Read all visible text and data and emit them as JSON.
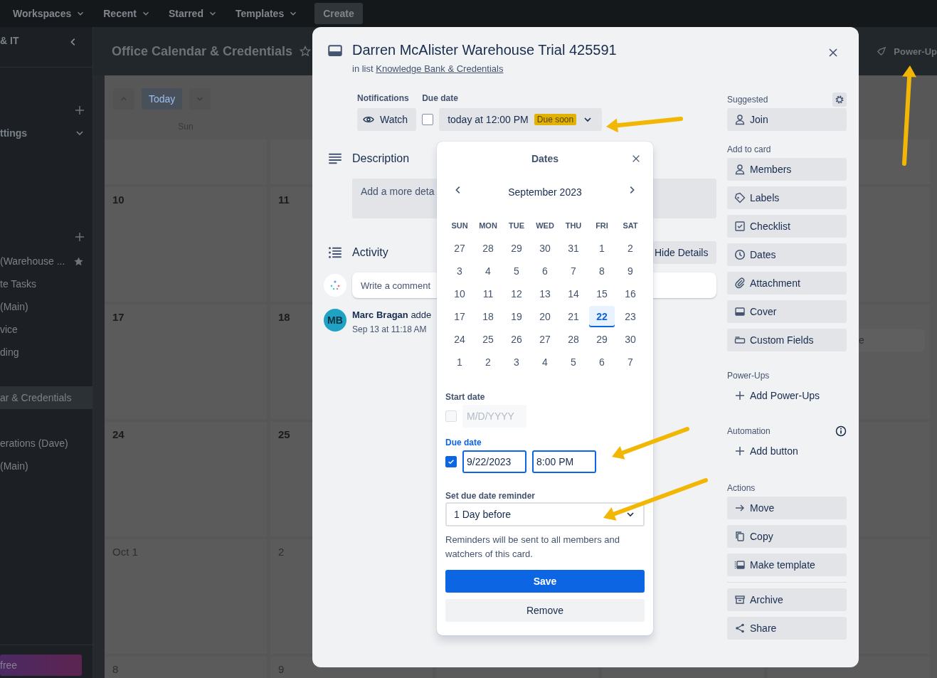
{
  "top_nav": {
    "menus": [
      {
        "label": "Workspaces"
      },
      {
        "label": "Recent"
      },
      {
        "label": "Starred"
      },
      {
        "label": "Templates"
      }
    ],
    "create_button": "Create"
  },
  "sidebar": {
    "workspace": "& IT",
    "section": "ttings",
    "groups": [
      {
        "items": [
          {
            "label": "(Warehouse ...",
            "starred": true,
            "selected": false
          },
          {
            "label": "te Tasks",
            "starred": false,
            "selected": false
          },
          {
            "label": "(Main)",
            "starred": false,
            "selected": false
          },
          {
            "label": "vice",
            "starred": false,
            "selected": false
          },
          {
            "label": "ding",
            "starred": false,
            "selected": false
          }
        ]
      },
      {
        "items": [
          {
            "label": "ar & Credentials",
            "starred": false,
            "selected": true
          }
        ]
      },
      {
        "items": [
          {
            "label": "erations (Dave)",
            "starred": false,
            "selected": false
          },
          {
            "label": "(Main)",
            "starred": false,
            "selected": false
          }
        ]
      }
    ],
    "upgrade_button": "free"
  },
  "board": {
    "title": "Office Calendar & Credentials",
    "power_ups": "Power-Up",
    "calendar": {
      "today_button": "Today",
      "weekday": "Sun",
      "weeks": [
        {
          "days": [
            "10",
            "11"
          ],
          "current_month": true
        },
        {
          "days": [
            "17",
            "18"
          ],
          "current_month": true,
          "card": "e"
        },
        {
          "days": [
            "24",
            "25"
          ],
          "current_month": true
        },
        {
          "days": [
            "Oct 1",
            "2"
          ],
          "current_month": false
        },
        {
          "days": [
            "8",
            "9"
          ],
          "current_month": false
        }
      ]
    }
  },
  "card_modal": {
    "title": "Darren McAlister Warehouse Trial 425591",
    "list_prefix": "in list",
    "list_link": "Knowledge Bank & Credentials",
    "notifications_label": "Notifications",
    "watch_button": "Watch",
    "due_date_label": "Due date",
    "due_complete": false,
    "due_date_value": "today at 12:00 PM",
    "due_badge": "Due soon",
    "description_heading": "Description",
    "description_placeholder": "Add a more deta",
    "activity_heading": "Activity",
    "hide_details_button": "Hide Details",
    "comment_placeholder": "Write a comment",
    "activity_items": [
      {
        "initials": "MB",
        "author": "Marc Bragan",
        "action": "adde",
        "time": "Sep 13 at 11:18 AM"
      }
    ],
    "sidebar": [
      {
        "title": "Suggested",
        "kind": "settings",
        "buttons": [
          {
            "label": "Join",
            "kind": "filled"
          }
        ]
      },
      {
        "title": "Add to card",
        "kind": "plain",
        "buttons": [
          {
            "label": "Members",
            "kind": "filled"
          },
          {
            "label": "Labels",
            "kind": "filled"
          },
          {
            "label": "Checklist",
            "kind": "filled"
          },
          {
            "label": "Dates",
            "kind": "filled"
          },
          {
            "label": "Attachment",
            "kind": "filled"
          },
          {
            "label": "Cover",
            "kind": "filled"
          },
          {
            "label": "Custom Fields",
            "kind": "filled"
          }
        ]
      },
      {
        "title": "Power-Ups",
        "kind": "plain",
        "buttons": [
          {
            "label": "Add Power-Ups",
            "kind": "add"
          }
        ]
      },
      {
        "title": "Automation",
        "kind": "info",
        "buttons": [
          {
            "label": "Add button",
            "kind": "add"
          }
        ]
      },
      {
        "title": "Actions",
        "kind": "plain",
        "buttons": [
          {
            "label": "Move",
            "kind": "filled"
          },
          {
            "label": "Copy",
            "kind": "filled"
          },
          {
            "label": "Make template",
            "kind": "filled"
          },
          {
            "label": "Archive",
            "kind": "filled",
            "divider_before": true
          },
          {
            "label": "Share",
            "kind": "filled"
          }
        ]
      }
    ]
  },
  "dates_popover": {
    "title": "Dates",
    "month": "September 2023",
    "weekdays": [
      "SUN",
      "MON",
      "TUE",
      "WED",
      "THU",
      "FRI",
      "SAT"
    ],
    "weeks": [
      [
        {
          "day": "27",
          "selected": false
        },
        {
          "day": "28",
          "selected": false
        },
        {
          "day": "29",
          "selected": false
        },
        {
          "day": "30",
          "selected": false
        },
        {
          "day": "31",
          "selected": false
        },
        {
          "day": "1",
          "selected": false
        },
        {
          "day": "2",
          "selected": false
        }
      ],
      [
        {
          "day": "3",
          "selected": false
        },
        {
          "day": "4",
          "selected": false
        },
        {
          "day": "5",
          "selected": false
        },
        {
          "day": "6",
          "selected": false
        },
        {
          "day": "7",
          "selected": false
        },
        {
          "day": "8",
          "selected": false
        },
        {
          "day": "9",
          "selected": false
        }
      ],
      [
        {
          "day": "10",
          "selected": false
        },
        {
          "day": "11",
          "selected": false
        },
        {
          "day": "12",
          "selected": false
        },
        {
          "day": "13",
          "selected": false
        },
        {
          "day": "14",
          "selected": false
        },
        {
          "day": "15",
          "selected": false
        },
        {
          "day": "16",
          "selected": false
        }
      ],
      [
        {
          "day": "17",
          "selected": false
        },
        {
          "day": "18",
          "selected": false
        },
        {
          "day": "19",
          "selected": false
        },
        {
          "day": "20",
          "selected": false
        },
        {
          "day": "21",
          "selected": false
        },
        {
          "day": "22",
          "selected": true
        },
        {
          "day": "23",
          "selected": false
        }
      ],
      [
        {
          "day": "24",
          "selected": false
        },
        {
          "day": "25",
          "selected": false
        },
        {
          "day": "26",
          "selected": false
        },
        {
          "day": "27",
          "selected": false
        },
        {
          "day": "28",
          "selected": false
        },
        {
          "day": "29",
          "selected": false
        },
        {
          "day": "30",
          "selected": false
        }
      ],
      [
        {
          "day": "1",
          "selected": false
        },
        {
          "day": "2",
          "selected": false
        },
        {
          "day": "3",
          "selected": false
        },
        {
          "day": "4",
          "selected": false
        },
        {
          "day": "5",
          "selected": false
        },
        {
          "day": "6",
          "selected": false
        },
        {
          "day": "7",
          "selected": false
        }
      ]
    ],
    "start_date": {
      "label": "Start date",
      "enabled": false,
      "placeholder": "M/D/YYYY"
    },
    "due_date": {
      "label": "Due date",
      "enabled": true,
      "date": "9/22/2023",
      "time": "8:00 PM"
    },
    "reminder": {
      "label": "Set due date reminder",
      "value": "1 Day before"
    },
    "note": "Reminders will be sent to all members and watchers of this card.",
    "save_button": "Save",
    "remove_button": "Remove"
  },
  "annotations": [
    {
      "kind": "arrow"
    },
    {
      "kind": "arrow"
    },
    {
      "kind": "arrow"
    },
    {
      "kind": "arrow"
    }
  ]
}
